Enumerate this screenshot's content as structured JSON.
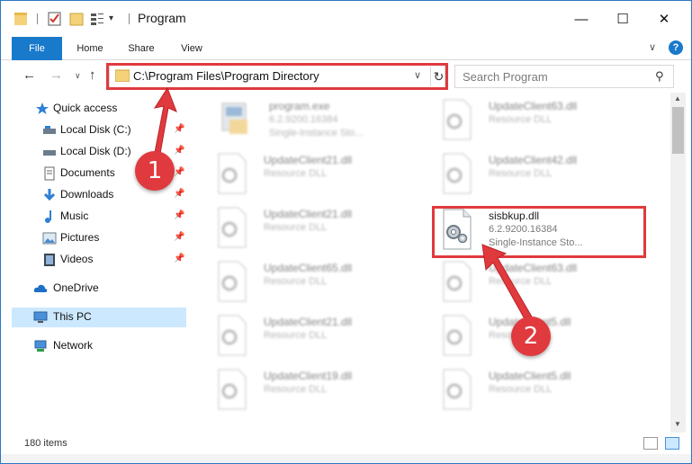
{
  "window": {
    "title": "Program",
    "minimize_glyph": "—",
    "maximize_glyph": "☐",
    "close_glyph": "✕"
  },
  "ribbon": {
    "tabs": [
      "File",
      "Home",
      "Share",
      "View"
    ],
    "help_glyph": "?"
  },
  "address": {
    "path": "C:\\Program Files\\Program Directory",
    "search_placeholder": "Search Program"
  },
  "nav": {
    "items": [
      {
        "label": "Quick access",
        "icon": "star-icon",
        "pinned": false
      },
      {
        "label": "Local Disk (C:)",
        "icon": "drive-icon",
        "pinned": true
      },
      {
        "label": "Local Disk (D:)",
        "icon": "drive-icon",
        "pinned": true
      },
      {
        "label": "Documents",
        "icon": "documents-icon",
        "pinned": true
      },
      {
        "label": "Downloads",
        "icon": "download-icon",
        "pinned": true
      },
      {
        "label": "Music",
        "icon": "music-icon",
        "pinned": true
      },
      {
        "label": "Pictures",
        "icon": "pictures-icon",
        "pinned": true
      },
      {
        "label": "Videos",
        "icon": "videos-icon",
        "pinned": true
      },
      {
        "label": "OneDrive",
        "icon": "cloud-icon",
        "pinned": false
      },
      {
        "label": "This PC",
        "icon": "computer-icon",
        "pinned": false,
        "selected": true
      },
      {
        "label": "Network",
        "icon": "network-icon",
        "pinned": false
      }
    ]
  },
  "files": [
    {
      "name": "program.exe",
      "version": "6.2.9200.16384",
      "desc": "Single-Instance Sto...",
      "kind": "exe",
      "blurred": true
    },
    {
      "name": "UpdateClient63.dll",
      "version": "Resource DLL",
      "desc": "",
      "kind": "dll",
      "blurred": true
    },
    {
      "name": "UpdateClient21.dll",
      "version": "Resource DLL",
      "desc": "",
      "kind": "dll",
      "blurred": true
    },
    {
      "name": "UpdateClient42.dll",
      "version": "Resource DLL",
      "desc": "",
      "kind": "dll",
      "blurred": true
    },
    {
      "name": "UpdateClient21.dll",
      "version": "Resource DLL",
      "desc": "",
      "kind": "dll",
      "blurred": true
    },
    {
      "name": "sisbkup.dll",
      "version": "6.2.9200.16384",
      "desc": "Single-Instance Sto...",
      "kind": "dll",
      "blurred": false
    },
    {
      "name": "UpdateClient65.dll",
      "version": "Resource DLL",
      "desc": "",
      "kind": "dll",
      "blurred": true
    },
    {
      "name": "UpdateClient63.dll",
      "version": "Resource DLL",
      "desc": "",
      "kind": "dll",
      "blurred": true
    },
    {
      "name": "UpdateClient21.dll",
      "version": "Resource DLL",
      "desc": "",
      "kind": "dll",
      "blurred": true
    },
    {
      "name": "UpdateClient5.dll",
      "version": "Resource DLL",
      "desc": "",
      "kind": "dll",
      "blurred": true
    },
    {
      "name": "UpdateClient19.dll",
      "version": "Resource DLL",
      "desc": "",
      "kind": "dll",
      "blurred": true
    },
    {
      "name": "UpdateClient5.dll",
      "version": "Resource DLL",
      "desc": "",
      "kind": "dll",
      "blurred": true
    }
  ],
  "status": {
    "item_count": "180 items"
  },
  "annotations": {
    "step1": "1",
    "step2": "2"
  },
  "colors": {
    "accent": "#1979ca",
    "highlight_red": "#e03a3e",
    "selection": "#cce8ff"
  }
}
